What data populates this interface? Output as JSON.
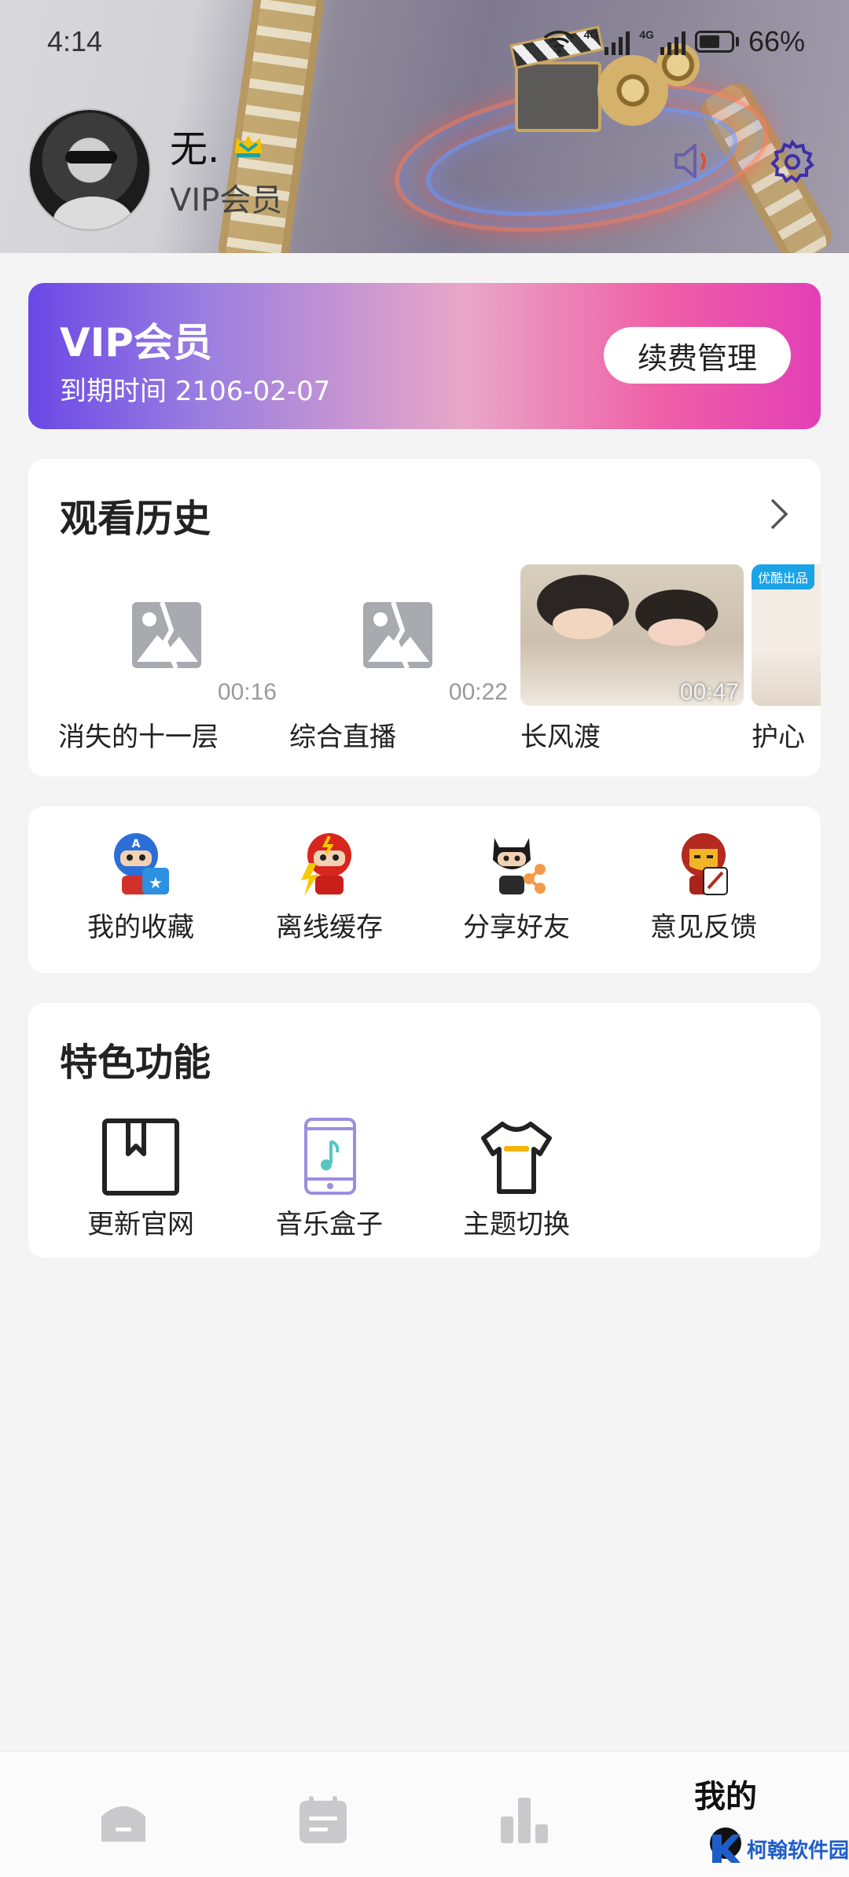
{
  "status_bar": {
    "time": "4:14",
    "network_1": "4G",
    "network_2": "4G",
    "battery": "66%",
    "battery_level": 0.66
  },
  "header": {
    "username": "无.",
    "user_level": "VIP会员",
    "icons": [
      "crown-icon",
      "volume-icon",
      "gear-icon"
    ]
  },
  "vip_card": {
    "title": "VIP会员",
    "expire_text": "到期时间 2106-02-07",
    "renew_button": "续费管理"
  },
  "history": {
    "title": "观看历史",
    "items": [
      {
        "title": "消失的十一层",
        "duration": "00:16",
        "thumb": "placeholder"
      },
      {
        "title": "综合直播",
        "duration": "00:22",
        "thumb": "placeholder"
      },
      {
        "title": "长风渡",
        "duration": "00:47",
        "thumb": "poster"
      },
      {
        "title": "护心",
        "duration": "",
        "thumb": "poster",
        "badge": "优酷出品"
      }
    ]
  },
  "quick_actions": [
    {
      "label": "我的收藏",
      "icon": "captain-america-icon"
    },
    {
      "label": "离线缓存",
      "icon": "flash-hero-icon"
    },
    {
      "label": "分享好友",
      "icon": "batman-share-icon"
    },
    {
      "label": "意见反馈",
      "icon": "iron-man-feedback-icon"
    }
  ],
  "features": {
    "title": "特色功能",
    "items": [
      {
        "label": "更新官网",
        "icon": "bookmark-icon"
      },
      {
        "label": "音乐盒子",
        "icon": "music-phone-icon"
      },
      {
        "label": "主题切换",
        "icon": "tshirt-icon"
      }
    ]
  },
  "bottom_nav": {
    "items": [
      {
        "icon": "home-icon"
      },
      {
        "icon": "schedule-icon"
      },
      {
        "icon": "ranking-icon"
      },
      {
        "label": "我的",
        "active": true
      }
    ]
  },
  "watermark": {
    "text": "柯翰软件园"
  },
  "colors": {
    "vip_gradient_start": "#6a48e6",
    "vip_gradient_end": "#e33fb6",
    "background": "#f4f4f5"
  }
}
